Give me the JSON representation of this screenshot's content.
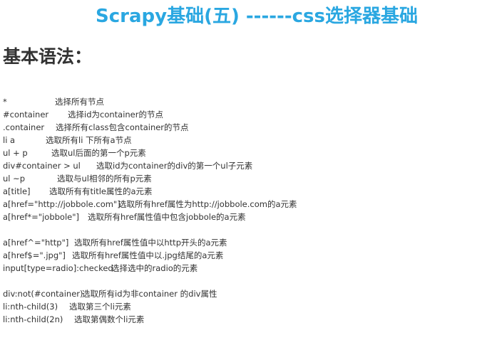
{
  "title": "Scrapy基础(五) ------css选择器基础",
  "heading": "基本语法：",
  "groups": [
    [
      {
        "selector": "*",
        "description": "选择所有节点"
      },
      {
        "selector": "#container",
        "description": "选择id为container的节点"
      },
      {
        "selector": ".container",
        "description": "选择所有class包含container的节点"
      },
      {
        "selector": "li a",
        "description": "选取所有li 下所有a节点"
      },
      {
        "selector": "ul + p",
        "description": "选取ul后面的第一个p元素"
      },
      {
        "selector": "div#container > ul",
        "description": "选取id为container的div的第一个ul子元素"
      },
      {
        "selector": "ul ~p",
        "description": "选取与ul相邻的所有p元素"
      },
      {
        "selector": "a[title]",
        "description": "选取所有有title属性的a元素"
      },
      {
        "selector": "a[href=\"http://jobbole.com\"]",
        "description": "选取所有href属性为http://jobbole.com的a元素"
      },
      {
        "selector": "a[href*=\"jobbole\"]",
        "description": "选取所有href属性值中包含jobbole的a元素"
      }
    ],
    [
      {
        "selector": "a[href^=\"http\"]",
        "description": "选取所有href属性值中以http开头的a元素"
      },
      {
        "selector": "a[href$=\".jpg\"]",
        "description": "选取所有href属性值中以.jpg结尾的a元素"
      },
      {
        "selector": "input[type=radio]:checked",
        "description": "选择选中的radio的元素"
      }
    ],
    [
      {
        "selector": "div:not(#container)",
        "description": "选取所有id为非container 的div属性"
      },
      {
        "selector": "li:nth-child(3)",
        "description": "选取第三个li元素"
      },
      {
        "selector": "li:nth-child(2n)",
        "description": "选取第偶数个li元素"
      }
    ]
  ]
}
